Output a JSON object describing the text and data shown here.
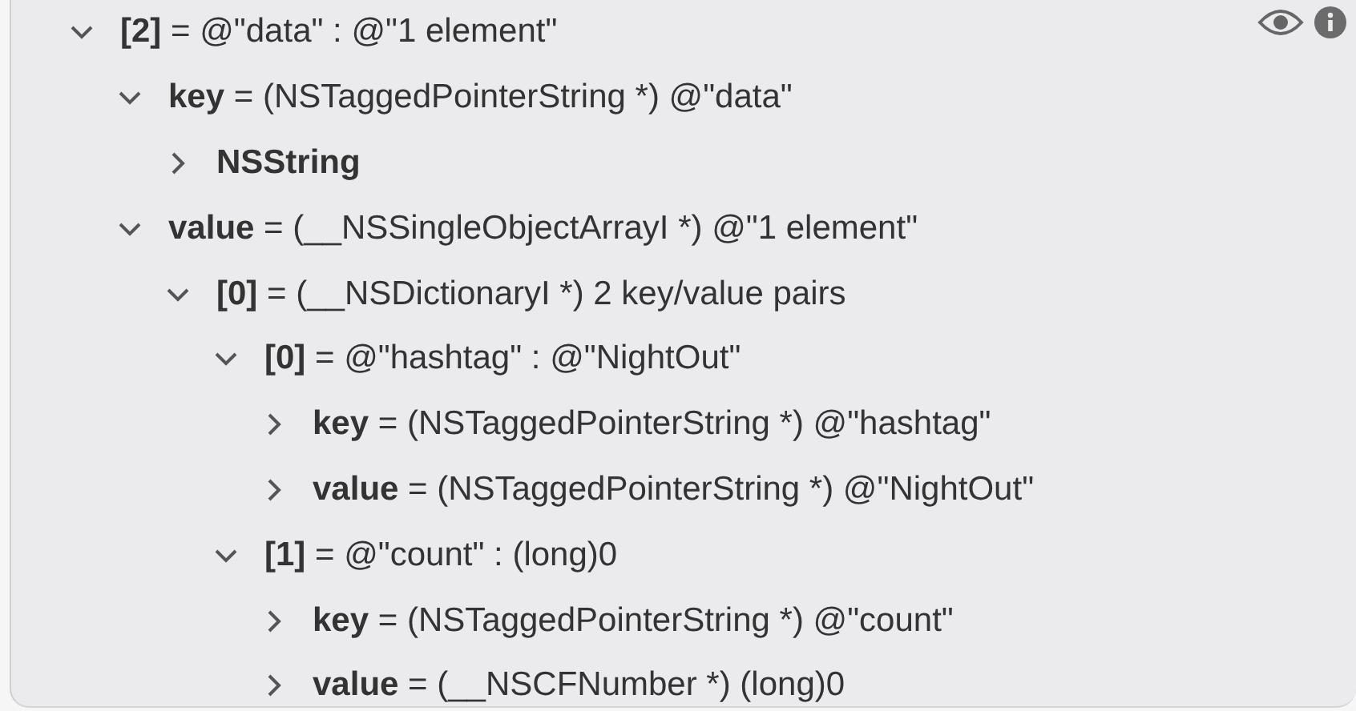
{
  "tree": [
    {
      "text": "**[2]** = @\"data\" : @\"1 element\"",
      "expanded": true,
      "children": [
        {
          "text": "**key** = (NSTaggedPointerString *) @\"data\"",
          "expanded": true,
          "children": [
            {
              "text": "**NSString**",
              "expanded": false
            }
          ]
        },
        {
          "text": "**value** = (__NSSingleObjectArrayI *) @\"1 element\"",
          "expanded": true,
          "children": [
            {
              "text": "**[0]** = (__NSDictionaryI *) 2 key/value pairs",
              "expanded": true,
              "children": [
                {
                  "text": "**[0]** = @\"hashtag\" : @\"NightOut\"",
                  "expanded": true,
                  "children": [
                    {
                      "text": "**key** = (NSTaggedPointerString *) @\"hashtag\"",
                      "expanded": false
                    },
                    {
                      "text": "**value** = (NSTaggedPointerString *) @\"NightOut\"",
                      "expanded": false
                    }
                  ]
                },
                {
                  "text": "**[1]** = @\"count\" : (long)0",
                  "expanded": true,
                  "children": [
                    {
                      "text": "**key** = (NSTaggedPointerString *) @\"count\"",
                      "expanded": false
                    },
                    {
                      "text": "**value** = (__NSCFNumber *) (long)0",
                      "expanded": false
                    }
                  ]
                }
              ]
            }
          ]
        }
      ]
    }
  ]
}
